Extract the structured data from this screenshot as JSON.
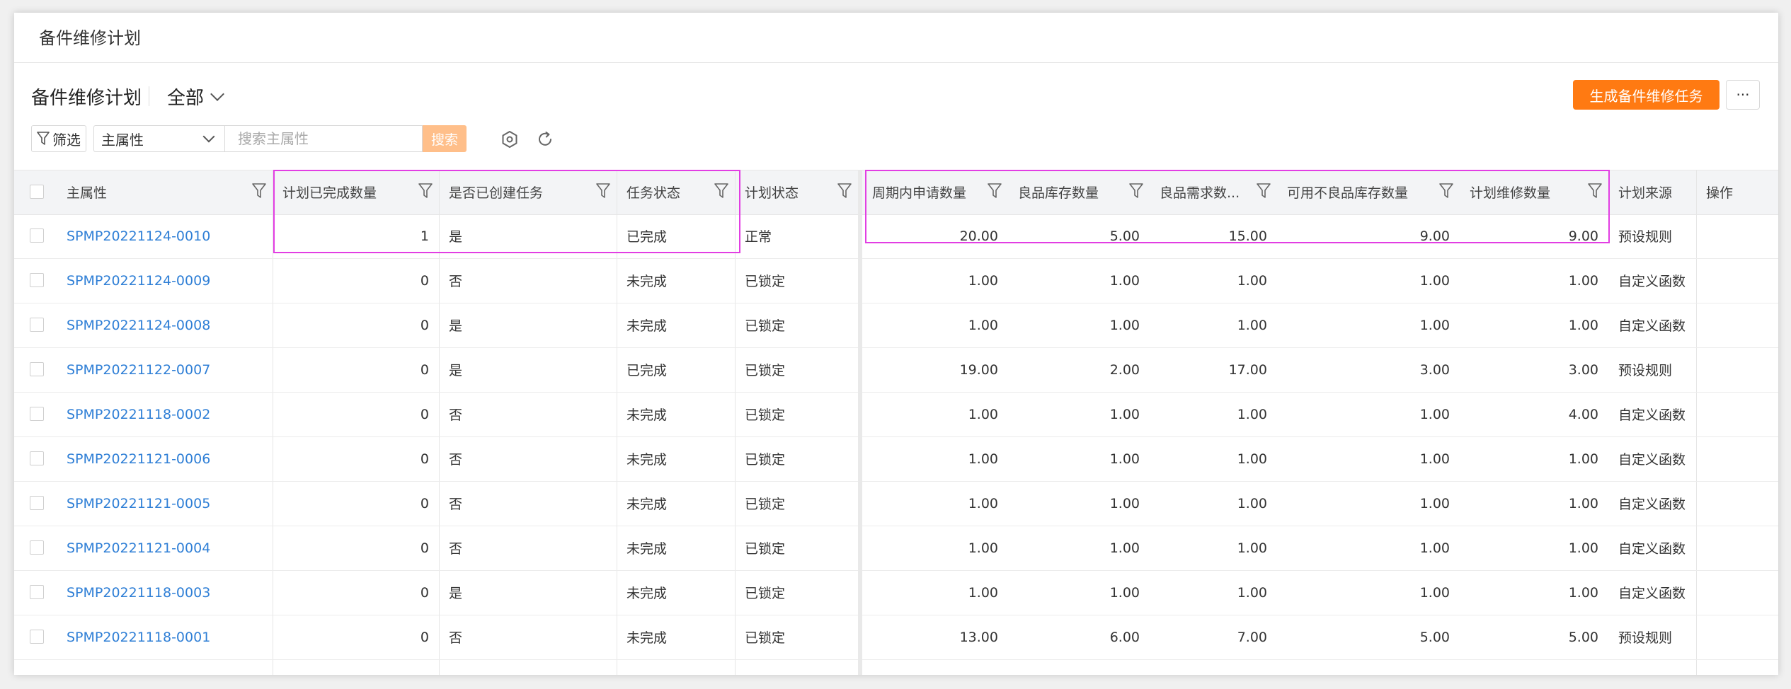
{
  "page": {
    "title": "备件维修计划"
  },
  "view": {
    "title": "备件维修计划",
    "scope": "全部"
  },
  "toolbar": {
    "primary_label": "生成备件维修任务",
    "more_label": "···",
    "filter_label": "筛选",
    "attr_select_value": "主属性",
    "search_placeholder": "搜索主属性",
    "search_label": "搜索"
  },
  "icons": {
    "settings": "settings-icon",
    "refresh": "refresh-icon",
    "filter": "funnel-icon",
    "dropdown": "chevron-down-icon"
  },
  "colors": {
    "primary": "#ff7a12",
    "link": "#2f7fd6",
    "highlight": "#e23ee3"
  },
  "table": {
    "columns": [
      "主属性",
      "计划已完成数量",
      "是否已创建任务",
      "任务状态",
      "计划状态",
      "周期内申请数量",
      "良品库存数量",
      "良品需求数...",
      "可用不良品库存数量",
      "计划维修数量",
      "计划来源",
      "操作"
    ],
    "rows": [
      [
        "SPMP20221124-0010",
        "1",
        "是",
        "已完成",
        "正常",
        "20.00",
        "5.00",
        "15.00",
        "9.00",
        "9.00",
        "预设规则"
      ],
      [
        "SPMP20221124-0009",
        "0",
        "否",
        "未完成",
        "已锁定",
        "1.00",
        "1.00",
        "1.00",
        "1.00",
        "1.00",
        "自定义函数"
      ],
      [
        "SPMP20221124-0008",
        "0",
        "是",
        "未完成",
        "已锁定",
        "1.00",
        "1.00",
        "1.00",
        "1.00",
        "1.00",
        "自定义函数"
      ],
      [
        "SPMP20221122-0007",
        "0",
        "是",
        "已完成",
        "已锁定",
        "19.00",
        "2.00",
        "17.00",
        "3.00",
        "3.00",
        "预设规则"
      ],
      [
        "SPMP20221118-0002",
        "0",
        "否",
        "未完成",
        "已锁定",
        "1.00",
        "1.00",
        "1.00",
        "1.00",
        "4.00",
        "自定义函数"
      ],
      [
        "SPMP20221121-0006",
        "0",
        "否",
        "未完成",
        "已锁定",
        "1.00",
        "1.00",
        "1.00",
        "1.00",
        "1.00",
        "自定义函数"
      ],
      [
        "SPMP20221121-0005",
        "0",
        "否",
        "未完成",
        "已锁定",
        "1.00",
        "1.00",
        "1.00",
        "1.00",
        "1.00",
        "自定义函数"
      ],
      [
        "SPMP20221121-0004",
        "0",
        "否",
        "未完成",
        "已锁定",
        "1.00",
        "1.00",
        "1.00",
        "1.00",
        "1.00",
        "自定义函数"
      ],
      [
        "SPMP20221118-0003",
        "0",
        "是",
        "未完成",
        "已锁定",
        "1.00",
        "1.00",
        "1.00",
        "1.00",
        "1.00",
        "自定义函数"
      ],
      [
        "SPMP20221118-0001",
        "0",
        "否",
        "未完成",
        "已锁定",
        "13.00",
        "6.00",
        "7.00",
        "5.00",
        "5.00",
        "预设规则"
      ]
    ]
  }
}
